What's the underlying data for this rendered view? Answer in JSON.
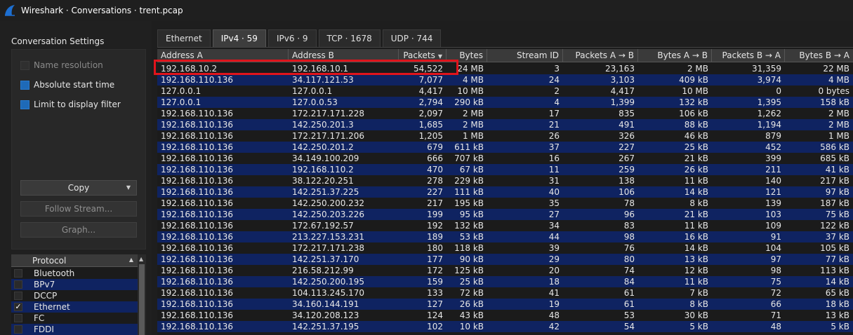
{
  "window": {
    "title": "Wireshark · Conversations · trent.pcap"
  },
  "settings": {
    "title": "Conversation Settings",
    "name_resolution": "Name resolution",
    "absolute_start_time": "Absolute start time",
    "limit_to_display_filter": "Limit to display filter"
  },
  "buttons": {
    "copy": "Copy",
    "follow_stream": "Follow Stream...",
    "graph": "Graph..."
  },
  "protocols": {
    "header": "Protocol",
    "items": [
      {
        "label": "Bluetooth",
        "checked": false
      },
      {
        "label": "BPv7",
        "checked": false
      },
      {
        "label": "DCCP",
        "checked": false
      },
      {
        "label": "Ethernet",
        "checked": true
      },
      {
        "label": "FC",
        "checked": false
      },
      {
        "label": "FDDI",
        "checked": false
      }
    ]
  },
  "tabs": [
    "Ethernet",
    "IPv4 · 59",
    "IPv6 · 9",
    "TCP · 1678",
    "UDP · 744"
  ],
  "table": {
    "columns": [
      "Address A",
      "Address B",
      "Packets",
      "Bytes",
      "Stream ID",
      "Packets A → B",
      "Bytes A → B",
      "Packets B → A",
      "Bytes B → A"
    ],
    "rows": [
      [
        "192.168.10.2",
        "192.168.10.1",
        "54,522",
        "24 MB",
        "3",
        "23,163",
        "2 MB",
        "31,359",
        "22 MB"
      ],
      [
        "192.168.110.136",
        "34.117.121.53",
        "7,077",
        "4 MB",
        "24",
        "3,103",
        "409 kB",
        "3,974",
        "4 MB"
      ],
      [
        "127.0.0.1",
        "127.0.0.1",
        "4,417",
        "10 MB",
        "2",
        "4,417",
        "10 MB",
        "0",
        "0 bytes"
      ],
      [
        "127.0.0.1",
        "127.0.0.53",
        "2,794",
        "290 kB",
        "4",
        "1,399",
        "132 kB",
        "1,395",
        "158 kB"
      ],
      [
        "192.168.110.136",
        "172.217.171.228",
        "2,097",
        "2 MB",
        "17",
        "835",
        "106 kB",
        "1,262",
        "2 MB"
      ],
      [
        "192.168.110.136",
        "142.250.201.3",
        "1,685",
        "2 MB",
        "21",
        "491",
        "88 kB",
        "1,194",
        "2 MB"
      ],
      [
        "192.168.110.136",
        "172.217.171.206",
        "1,205",
        "1 MB",
        "26",
        "326",
        "46 kB",
        "879",
        "1 MB"
      ],
      [
        "192.168.110.136",
        "142.250.201.2",
        "679",
        "611 kB",
        "37",
        "227",
        "25 kB",
        "452",
        "586 kB"
      ],
      [
        "192.168.110.136",
        "34.149.100.209",
        "666",
        "707 kB",
        "16",
        "267",
        "21 kB",
        "399",
        "685 kB"
      ],
      [
        "192.168.110.136",
        "192.168.110.2",
        "470",
        "67 kB",
        "11",
        "259",
        "26 kB",
        "211",
        "41 kB"
      ],
      [
        "192.168.110.136",
        "38.122.20.251",
        "278",
        "229 kB",
        "31",
        "138",
        "11 kB",
        "140",
        "217 kB"
      ],
      [
        "192.168.110.136",
        "142.251.37.225",
        "227",
        "111 kB",
        "40",
        "106",
        "14 kB",
        "121",
        "97 kB"
      ],
      [
        "192.168.110.136",
        "142.250.200.232",
        "217",
        "195 kB",
        "35",
        "78",
        "8 kB",
        "139",
        "187 kB"
      ],
      [
        "192.168.110.136",
        "142.250.203.226",
        "199",
        "95 kB",
        "27",
        "96",
        "21 kB",
        "103",
        "75 kB"
      ],
      [
        "192.168.110.136",
        "172.67.192.57",
        "192",
        "132 kB",
        "34",
        "83",
        "11 kB",
        "109",
        "122 kB"
      ],
      [
        "192.168.110.136",
        "213.227.153.231",
        "189",
        "53 kB",
        "44",
        "98",
        "16 kB",
        "91",
        "37 kB"
      ],
      [
        "192.168.110.136",
        "172.217.171.238",
        "180",
        "118 kB",
        "39",
        "76",
        "14 kB",
        "104",
        "105 kB"
      ],
      [
        "192.168.110.136",
        "142.251.37.170",
        "177",
        "90 kB",
        "29",
        "80",
        "13 kB",
        "97",
        "77 kB"
      ],
      [
        "192.168.110.136",
        "216.58.212.99",
        "172",
        "125 kB",
        "20",
        "74",
        "12 kB",
        "98",
        "113 kB"
      ],
      [
        "192.168.110.136",
        "142.250.200.195",
        "159",
        "25 kB",
        "18",
        "84",
        "11 kB",
        "75",
        "14 kB"
      ],
      [
        "192.168.110.136",
        "104.113.245.170",
        "133",
        "72 kB",
        "41",
        "61",
        "7 kB",
        "72",
        "65 kB"
      ],
      [
        "192.168.110.136",
        "34.160.144.191",
        "127",
        "26 kB",
        "19",
        "61",
        "8 kB",
        "66",
        "18 kB"
      ],
      [
        "192.168.110.136",
        "34.120.208.123",
        "124",
        "43 kB",
        "48",
        "53",
        "30 kB",
        "71",
        "13 kB"
      ],
      [
        "192.168.110.136",
        "142.251.37.195",
        "102",
        "10 kB",
        "42",
        "54",
        "5 kB",
        "48",
        "5 kB"
      ]
    ]
  },
  "colors": {
    "row_alt": "#0f2361",
    "highlight": "#e0141c",
    "checkbox_on": "#1e6ab8"
  }
}
